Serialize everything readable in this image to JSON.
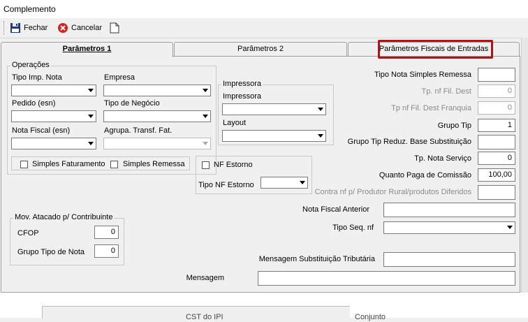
{
  "window": {
    "title": "Complemento"
  },
  "toolbar": {
    "close_label": "Fechar",
    "cancel_label": "Cancelar"
  },
  "tabs": [
    {
      "label": "Parâmetros 1"
    },
    {
      "label": "Parâmetros 2"
    },
    {
      "label": "Parâmetros Fiscais de Entradas"
    }
  ],
  "operacoes": {
    "caption": "Operações",
    "tipo_imp_nota": "Tipo Imp. Nota",
    "empresa": "Empresa",
    "pedido": "Pedido (esn)",
    "tipo_negocio": "Tipo de Negócio",
    "nota_fiscal": "Nota Fiscal (esn)",
    "agrupa": "Agrupa. Transf. Fat.",
    "simples_faturamento": "Simples Faturamento",
    "simples_remessa": "Simples Remessa"
  },
  "impressora": {
    "caption": "Impressora",
    "label": "Impressora",
    "layout": "Layout"
  },
  "estorno": {
    "nf_estorno": "NF Estorno",
    "tipo_nf_estorno": "Tipo NF Estorno"
  },
  "mov": {
    "caption": "Mov. Atacado p/ Contribuinte",
    "cfop_label": "CFOP",
    "cfop_value": "0",
    "grupo_label": "Grupo Tipo de Nota",
    "grupo_value": "0"
  },
  "right": {
    "tipo_nota_simples": "Tipo Nota Simples Remessa",
    "tp_nf_fil_dest": "Tp. nf Fil. Dest",
    "tp_nf_fil_dest_value": "0",
    "tp_nf_fil_franquia": "Tp nf Fil. Dest Franquia",
    "tp_nf_fil_franquia_value": "0",
    "grupo_tip": "Grupo Tip",
    "grupo_tip_value": "1",
    "grupo_tip_reduz": "Grupo Tip Reduz. Base Substituição",
    "tp_nota_servico": "Tp. Nota Serviço",
    "tp_nota_servico_value": "0",
    "quanto_paga": "Quanto Paga de Comissão",
    "quanto_paga_value": "100,00",
    "contra_nf": "Contra nf p/ Produtor Rural/produtos Diferidos",
    "nota_fiscal_anterior": "Nota Fiscal Anterior",
    "tipo_seq_nf": "Tipo Seq. nf",
    "mensagem_subst": "Mensagem Substituição Tributária",
    "mensagem": "Mensagem"
  },
  "behind": {
    "label_a": "CST do IPI",
    "label_b": "Conjunto"
  }
}
